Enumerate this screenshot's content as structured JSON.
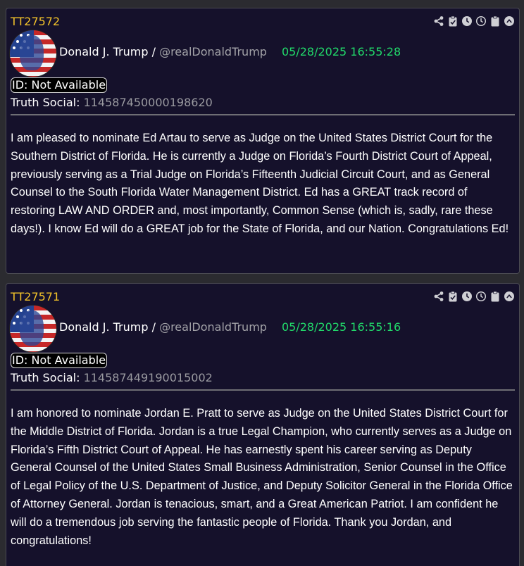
{
  "colors": {
    "card_background": "#15112b",
    "post_id": "#f2c22a",
    "timestamp": "#21d96a",
    "handle": "#a3a3a8",
    "icons": "#cfcfd4"
  },
  "toolbar_icons": [
    "share-icon",
    "clipboard-check-icon",
    "clock-solid-icon",
    "clock-outline-icon",
    "clipboard-icon",
    "chevron-up-circle-icon"
  ],
  "posts": [
    {
      "id": "TT27572",
      "author": "Donald J. Trump",
      "separator": " / ",
      "handle": "@realDonaldTrump",
      "timestamp": "05/28/2025 16:55:28",
      "id_badge": "ID: Not Available",
      "truth_social_label": "Truth Social:",
      "truth_social_id": "114587450000198620",
      "body": "I am pleased to nominate Ed Artau to serve as Judge on the United States District Court for the Southern District of Florida. He is currently a Judge on Florida’s Fourth District Court of Appeal, previously serving as a Trial Judge on Florida’s Fifteenth Judicial Circuit Court, and as General Counsel to the South Florida Water Management District. Ed has a GREAT track record of restoring LAW AND ORDER and, most importantly, Common Sense (which is, sadly, rare these days!). I know Ed will do a GREAT job for the State of Florida, and our Nation. Congratulations Ed!"
    },
    {
      "id": "TT27571",
      "author": "Donald J. Trump",
      "separator": " / ",
      "handle": "@realDonaldTrump",
      "timestamp": "05/28/2025 16:55:16",
      "id_badge": "ID: Not Available",
      "truth_social_label": "Truth Social:",
      "truth_social_id": "114587449190015002",
      "body": "I am honored to nominate Jordan E. Pratt to serve as Judge on the United States District Court for the Middle District of Florida. Jordan is a true Legal Champion, who currently serves as a Judge on Florida’s Fifth District Court of Appeal. He has earnestly spent his career serving as Deputy General Counsel of the United States Small Business Administration, Senior Counsel in the Office of Legal Policy of the U.S. Department of Justice, and Deputy Solicitor General in the Florida Office of Attorney General. Jordan is tenacious, smart, and a Great American Patriot. I am confident he will do a tremendous job serving the fantastic people of Florida. Thank you Jordan, and congratulations!"
    }
  ]
}
